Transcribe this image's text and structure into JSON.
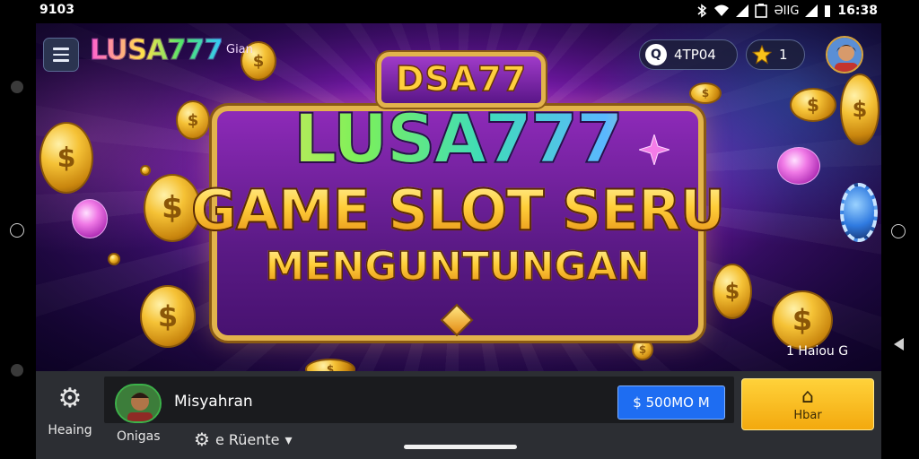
{
  "status_bar": {
    "left_text": "9103",
    "right_text": "ƏIIG",
    "clock": "16:38",
    "icons": [
      "bluetooth-icon",
      "wifi-icon",
      "signal-icon",
      "battery-icon"
    ]
  },
  "game": {
    "logo": "LUSA777",
    "logo_sub": "Gian",
    "coins_value": "4TP04",
    "stars_value": "1",
    "plaque": "DSA77",
    "big_logo": "LUSA777",
    "headline_1": "GAME SLOT SERU",
    "headline_2": "MENGUNTUNGAN",
    "corner_note": "1 Haiou G",
    "colors": {
      "gold": "#e2b34b",
      "purple": "#7d1ab3",
      "accent_blue": "#1e6df2",
      "accent_yellow": "#ffd23a"
    }
  },
  "bottom": {
    "settings_label": "Heaing",
    "profile_label": "Onigas",
    "username": "Misyahran",
    "balance_button": "$ 500МО M",
    "home_label": "Hbar",
    "language": "e Rüente"
  }
}
